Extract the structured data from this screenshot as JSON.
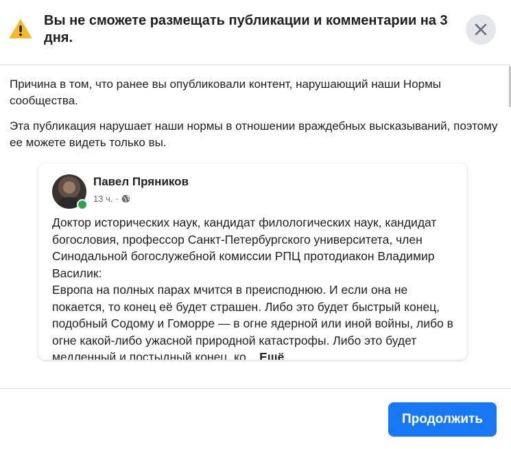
{
  "dialog": {
    "title": "Вы не сможете размещать публикации и комментарии на 3 дня.",
    "reason_text": "Причина в том, что ранее вы опубликовали контент, нарушающий наши Нормы сообщества.",
    "violation_text": "Эта публикация нарушает наши нормы в отношении враждебных высказываний, поэтому ее можете видеть только вы.",
    "continue_label": "Продолжить",
    "accent_color": "#1877f2",
    "warning_color": "#f7b928"
  },
  "post": {
    "author": "Павел Пряников",
    "time": "13 ч.",
    "separator": "·",
    "audience_icon": "globe-icon",
    "text": "Доктор исторических наук, кандидат филологических наук, кандидат богословия, профессор Санкт-Петербургского университета, член Синодальной богослужебной комиссии РПЦ протодиакон Владимир Василик:\nЕвропа на полных парах мчится в преисподнюю. И если она не покается, то конец её будет страшен. Либо это будет быстрый конец, подобный Содому и Гоморре — в огне ядерной или иной войны, либо в огне какой-либо ужасной природной катастрофы. Либо это будет медленный и постыдный конец, ко...",
    "more_label": "Ещё"
  },
  "icons": {
    "warning": "warning-triangle-icon",
    "close": "close-icon"
  }
}
